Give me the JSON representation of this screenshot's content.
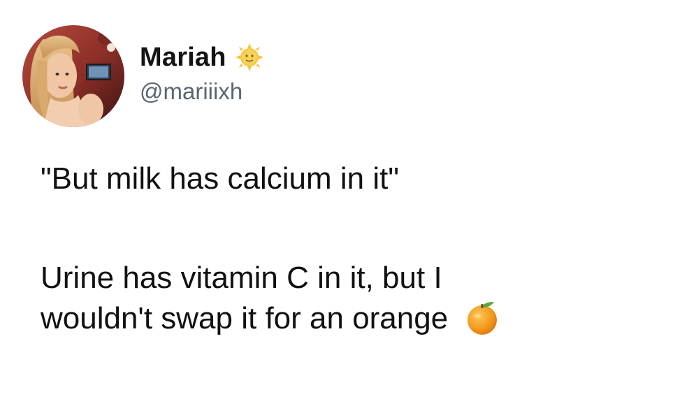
{
  "author": {
    "display_name": "Mariah",
    "handle": "@mariiixh",
    "name_emoji_icon": "sun-with-face-icon"
  },
  "tweet": {
    "line1": "\"But milk has calcium in it\"",
    "line2": "Urine has vitamin C in it, but I",
    "line3": "wouldn't swap it for an orange",
    "trailing_emoji_icon": "orange-icon"
  },
  "colors": {
    "background": "#ffffff",
    "text": "#111111",
    "handle": "#5b6670",
    "orange": "#f39a1d",
    "sun": "#f7c53a"
  }
}
